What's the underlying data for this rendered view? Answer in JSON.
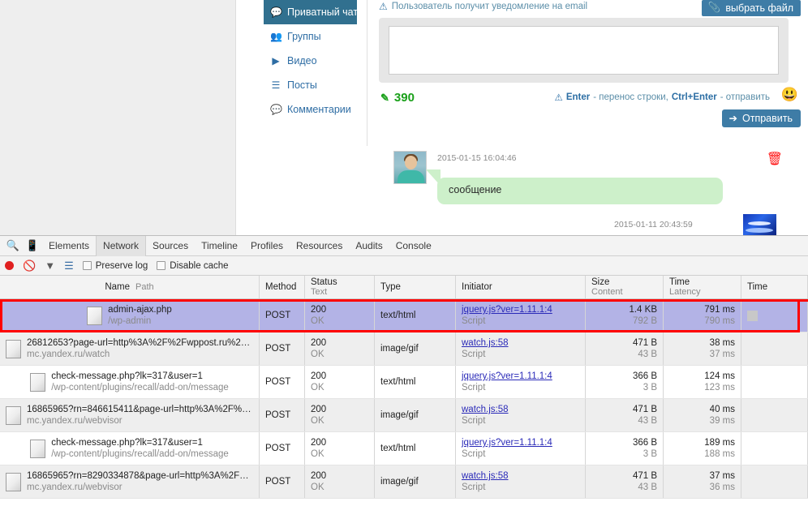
{
  "page": {
    "nav": {
      "items": [
        {
          "label": "Приватный чат",
          "icon": "chat-bubbles-icon",
          "active": true
        },
        {
          "label": "Группы",
          "icon": "users-group-icon",
          "active": false
        },
        {
          "label": "Видео",
          "icon": "video-play-icon",
          "active": false
        },
        {
          "label": "Посты",
          "icon": "list-icon",
          "active": false
        },
        {
          "label": "Комментарии",
          "icon": "comment-icon",
          "active": false
        }
      ]
    },
    "composer": {
      "notify_text": "Пользователь получит уведомление на email",
      "file_button": "выбрать файл",
      "file_button_icon": "paperclip-icon",
      "message_value": "",
      "message_placeholder": "",
      "counter": "390",
      "counter_icon": "edit-pencil-icon",
      "hint_prefix": "Enter",
      "hint_mid": " - перенос строки, ",
      "hint_key2": "Ctrl+Enter",
      "hint_suffix": " - отправить",
      "smiley_icon": "smiley-face-icon",
      "send_button": "Отправить",
      "send_button_icon": "arrow-right-icon"
    },
    "thread": {
      "message_timestamp": "2015-01-15 16:04:46",
      "message_text": "сообщение",
      "delete_icon": "trash-icon",
      "reply_timestamp": "2015-01-11 20:43:59"
    },
    "colors": {
      "accent_blue": "#3e7ca6",
      "active_tab_blue": "#31708f",
      "bubble_green": "#cdf0ca",
      "counter_green": "#1aa01a",
      "delete_red": "#ff1111"
    }
  },
  "devtools": {
    "tool_icons": [
      "search-icon",
      "device-toggle-icon"
    ],
    "tabs": [
      {
        "label": "Elements",
        "active": false
      },
      {
        "label": "Network",
        "active": true
      },
      {
        "label": "Sources",
        "active": false
      },
      {
        "label": "Timeline",
        "active": false
      },
      {
        "label": "Profiles",
        "active": false
      },
      {
        "label": "Resources",
        "active": false
      },
      {
        "label": "Audits",
        "active": false
      },
      {
        "label": "Console",
        "active": false
      }
    ],
    "filterbar": {
      "record_icon": "record-circle-icon",
      "clear_icon": "clear-prohibited-icon",
      "filter_icon": "funnel-filter-icon",
      "view_icon": "list-view-icon",
      "preserve_log": {
        "label": "Preserve log",
        "checked": false
      },
      "disable_cache": {
        "label": "Disable cache",
        "checked": false
      }
    },
    "network": {
      "columns": [
        {
          "t1": "Name",
          "t2": "Path"
        },
        {
          "t1": "Method",
          "t2": ""
        },
        {
          "t1": "Status",
          "t2": "Text"
        },
        {
          "t1": "Type",
          "t2": ""
        },
        {
          "t1": "Initiator",
          "t2": ""
        },
        {
          "t1": "Size",
          "t2": "Content"
        },
        {
          "t1": "Time",
          "t2": "Latency"
        },
        {
          "t1": "Time",
          "t2": ""
        }
      ],
      "rows": [
        {
          "name": "admin-ajax.php",
          "path": "/wp-admin",
          "method": "POST",
          "status": "200",
          "status_text": "OK",
          "type": "text/html",
          "initiator": "jquery.js?ver=1.11.1:4",
          "initiator_sub": "Script",
          "size": "1.4 KB",
          "content": "792 B",
          "time": "791 ms",
          "latency": "790 ms",
          "selected": true,
          "has_bar": true
        },
        {
          "name": "26812653?page-url=http%3A%2F%2Fwppost.ru%2F…",
          "path": "mc.yandex.ru/watch",
          "method": "POST",
          "status": "200",
          "status_text": "OK",
          "type": "image/gif",
          "initiator": "watch.js:58",
          "initiator_sub": "Script",
          "size": "471 B",
          "content": "43 B",
          "time": "38 ms",
          "latency": "37 ms",
          "selected": false,
          "has_bar": false
        },
        {
          "name": "check-message.php?lk=317&user=1",
          "path": "/wp-content/plugins/recall/add-on/message",
          "method": "POST",
          "status": "200",
          "status_text": "OK",
          "type": "text/html",
          "initiator": "jquery.js?ver=1.11.1:4",
          "initiator_sub": "Script",
          "size": "366 B",
          "content": "3 B",
          "time": "124 ms",
          "latency": "123 ms",
          "selected": false,
          "has_bar": false
        },
        {
          "name": "16865965?rn=846615411&page-url=http%3A%2F%2…",
          "path": "mc.yandex.ru/webvisor",
          "method": "POST",
          "status": "200",
          "status_text": "OK",
          "type": "image/gif",
          "initiator": "watch.js:58",
          "initiator_sub": "Script",
          "size": "471 B",
          "content": "43 B",
          "time": "40 ms",
          "latency": "39 ms",
          "selected": false,
          "has_bar": false
        },
        {
          "name": "check-message.php?lk=317&user=1",
          "path": "/wp-content/plugins/recall/add-on/message",
          "method": "POST",
          "status": "200",
          "status_text": "OK",
          "type": "text/html",
          "initiator": "jquery.js?ver=1.11.1:4",
          "initiator_sub": "Script",
          "size": "366 B",
          "content": "3 B",
          "time": "189 ms",
          "latency": "188 ms",
          "selected": false,
          "has_bar": false
        },
        {
          "name": "16865965?rn=8290334878&page-url=http%3A%2F%2…",
          "path": "mc.yandex.ru/webvisor",
          "method": "POST",
          "status": "200",
          "status_text": "OK",
          "type": "image/gif",
          "initiator": "watch.js:58",
          "initiator_sub": "Script",
          "size": "471 B",
          "content": "43 B",
          "time": "37 ms",
          "latency": "36 ms",
          "selected": false,
          "has_bar": false
        }
      ]
    }
  }
}
